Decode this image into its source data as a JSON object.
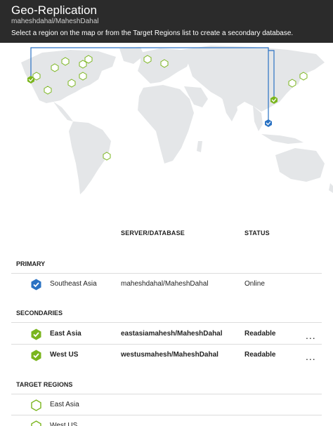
{
  "header": {
    "title": "Geo-Replication",
    "subtitle": "maheshdahal/MaheshDahal",
    "instructions": "Select a region on the map or from the Target Regions list to create a secondary database."
  },
  "columns": {
    "server": "SERVER/DATABASE",
    "status": "STATUS"
  },
  "sections": {
    "primary": "PRIMARY",
    "secondaries": "SECONDARIES",
    "targets": "TARGET REGIONS"
  },
  "primary": {
    "region": "Southeast Asia",
    "server": "maheshdahal/MaheshDahal",
    "status": "Online"
  },
  "secondaries": [
    {
      "region": "East Asia",
      "server": "eastasiamahesh/MaheshDahal",
      "status": "Readable",
      "more": "..."
    },
    {
      "region": "West US",
      "server": "westusmahesh/MaheshDahal",
      "status": "Readable",
      "more": "..."
    }
  ],
  "target_regions": [
    {
      "region": "East Asia"
    },
    {
      "region": "West US"
    }
  ],
  "colors": {
    "header_bg": "#2b2b2b",
    "primary_blue": "#2a72c3",
    "secondary_green": "#7ab51d",
    "land": "#e4e6e8"
  },
  "icons": {
    "primary": "blue-check-hexagon-icon",
    "secondary": "green-check-hexagon-icon",
    "target": "empty-green-hexagon-icon",
    "more": "ellipsis-icon"
  }
}
